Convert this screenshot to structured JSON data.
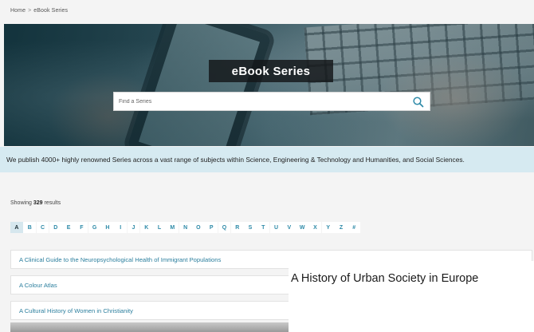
{
  "breadcrumb": {
    "home": "Home",
    "separator": ">",
    "current": "eBook Series"
  },
  "hero": {
    "title": "eBook Series"
  },
  "search": {
    "placeholder": "Find a Series",
    "icon": "search-icon"
  },
  "info_bar": {
    "text": "We publish 4000+ highly renowned Series across a vast range of subjects within Science, Engineering & Technology and Humanities, and Social Sciences."
  },
  "results": {
    "prefix": "Showing",
    "count": "329",
    "suffix": "results"
  },
  "alphabet": {
    "active": "A",
    "letters": [
      "A",
      "B",
      "C",
      "D",
      "E",
      "F",
      "G",
      "H",
      "I",
      "J",
      "K",
      "L",
      "M",
      "N",
      "O",
      "P",
      "Q",
      "R",
      "S",
      "T",
      "U",
      "V",
      "W",
      "X",
      "Y",
      "Z",
      "#"
    ]
  },
  "series_list": [
    "A Clinical Guide to the Neuropsychological Health of Immigrant Populations",
    "A Colour Atlas",
    "A Cultural History of Women in Christianity"
  ],
  "tooltip": {
    "text": "A History of Urban Society in Europe"
  },
  "colors": {
    "link": "#2c7f9e",
    "info_bar_bg": "#d6eaf1",
    "active_letter_bg": "#d6e7ee"
  }
}
